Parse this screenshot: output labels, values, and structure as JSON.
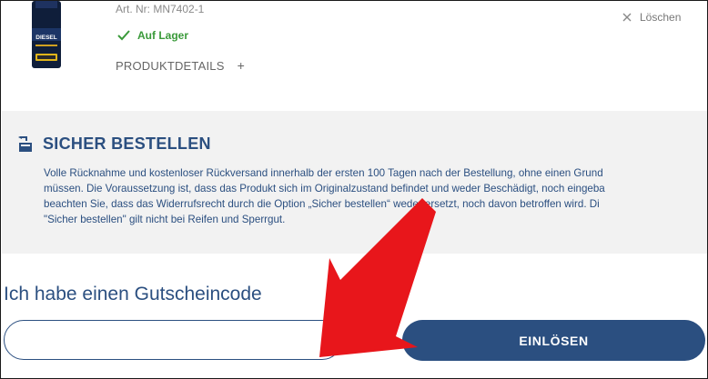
{
  "product": {
    "art_nr": "Art. Nr: MN7402-1",
    "stock_status": "Auf Lager",
    "details_label": "PRODUKTDETAILS",
    "details_toggle": "+",
    "remove_label": "Löschen",
    "image_brand_text": "DIESEL"
  },
  "safe_order": {
    "title": "SICHER BESTELLEN",
    "lines": [
      "Volle Rücknahme und kostenloser Rückversand innerhalb der ersten 100 Tagen nach der Bestellung, ohne einen Grund",
      "müssen. Die Voraussetzung ist, dass das Produkt sich im Originalzustand befindet und weder Beschädigt, noch eingeba",
      "beachten Sie, dass das Widerrufsrecht durch die Option „Sicher bestellen“ weder ersetzt, noch davon betroffen wird. Di",
      "\"Sicher bestellen\" gilt nicht bei Reifen und Sperrgut."
    ]
  },
  "voucher": {
    "heading": "Ich habe einen Gutscheincode",
    "input_value": "",
    "input_placeholder": "",
    "redeem_label": "EINLÖSEN"
  },
  "colors": {
    "brand_blue": "#2b4f80",
    "stock_green": "#3a9a3a",
    "annotation_red": "#e8161b",
    "info_bg": "#f2f2f2"
  },
  "icons": {
    "stock": "check-icon",
    "remove": "close-icon",
    "safe_order": "package-return-icon",
    "annotation": "arrow-down-left-icon"
  }
}
